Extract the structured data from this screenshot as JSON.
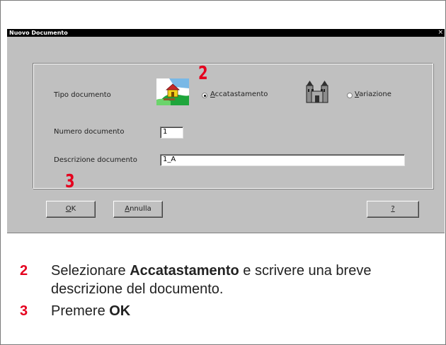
{
  "dialog": {
    "title": "Nuovo Documento",
    "close_glyph": "×"
  },
  "form": {
    "tipo_label": "Tipo documento",
    "radio_accatastamento": {
      "label_accel": "A",
      "label_rest": "ccatastamento",
      "checked": true
    },
    "radio_variazione": {
      "label_accel": "V",
      "label_rest": "ariazione",
      "checked": false
    },
    "numero_label": "Numero documento",
    "numero_value": "1",
    "descrizione_label": "Descrizione documento",
    "descrizione_value": "1_A"
  },
  "buttons": {
    "ok": {
      "accel": "O",
      "rest": "K"
    },
    "annulla": {
      "accel": "A",
      "rest": "nnulla"
    },
    "help": "?"
  },
  "callouts": {
    "step2": "2",
    "step3": "3"
  },
  "instructions": [
    {
      "num": "2",
      "pre": "Selezionare ",
      "bold": "Accatastamento",
      "post": " e scrivere una breve descrizione del documento."
    },
    {
      "num": "3",
      "pre": "Premere ",
      "bold": "OK",
      "post": ""
    }
  ],
  "icons": {
    "accatastamento": "house-landscape-icon",
    "variazione": "castle-icon"
  },
  "colors": {
    "accent_red": "#e5001e",
    "window_gray": "#c0c0c0",
    "titlebar": "#000000"
  }
}
